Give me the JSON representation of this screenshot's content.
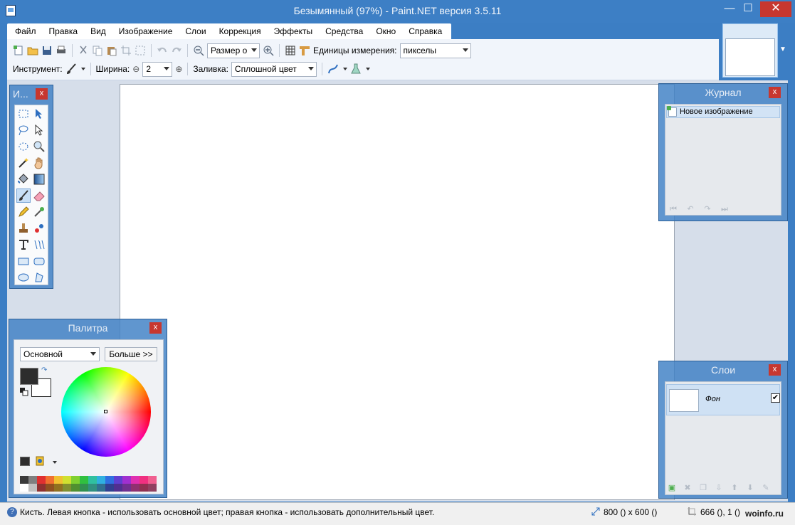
{
  "window": {
    "title": "Безымянный (97%) - Paint.NET версия 3.5.11",
    "minimize_label": "—",
    "maximize_label": "☐",
    "close_label": "✕"
  },
  "menu": {
    "items": [
      "Файл",
      "Правка",
      "Вид",
      "Изображение",
      "Слои",
      "Коррекция",
      "Эффекты",
      "Средства",
      "Окно",
      "Справка"
    ]
  },
  "toolbar": {
    "zoom_value": "Размер о",
    "units_label": "Единицы измерения:",
    "units_value": "пикселы",
    "tool_label": "Инструмент:",
    "width_label": "Ширина:",
    "width_value": "2",
    "fill_label": "Заливка:",
    "fill_value": "Сплошной цвет",
    "minus_label": "⊖",
    "plus_label": "⊕"
  },
  "tools_panel": {
    "title": "И...",
    "close_label": "x",
    "tools": [
      "rectangle-select",
      "move-selection",
      "lasso-select",
      "move-selected-pixels",
      "ellipse-select",
      "zoom",
      "magic-wand",
      "pan",
      "paint-bucket",
      "gradient",
      "paintbrush",
      "eraser",
      "pencil",
      "color-picker",
      "clone-stamp",
      "recolor",
      "text",
      "line-curve",
      "rectangle",
      "rounded-rectangle",
      "ellipse",
      "freeform-shape"
    ],
    "selected": "paintbrush"
  },
  "palette_panel": {
    "title": "Палитра",
    "close_label": "x",
    "palette_value": "Основной",
    "more_button": "Больше >>",
    "primary_color": "#2d2d2d",
    "secondary_color": "#ffffff",
    "swatches": [
      "#3a3a3a",
      "#7f7f7f",
      "#e03030",
      "#f07030",
      "#f0c030",
      "#d0e030",
      "#80d030",
      "#30c040",
      "#30c0a0",
      "#30b0e0",
      "#3070e0",
      "#6040d0",
      "#a030d0",
      "#e030b0",
      "#f03080",
      "#f06090",
      "#ffffff",
      "#c0c0c0",
      "#903030",
      "#905020",
      "#907020",
      "#809030",
      "#509030",
      "#309050",
      "#309080",
      "#307090",
      "#304090",
      "#503090",
      "#703090",
      "#903070",
      "#903050",
      "#904060"
    ]
  },
  "journal_panel": {
    "title": "Журнал",
    "close_label": "x",
    "items": [
      "Новое изображение"
    ]
  },
  "layers_panel": {
    "title": "Слои",
    "close_label": "x",
    "layers": [
      {
        "name": "Фон",
        "visible": true
      }
    ]
  },
  "statusbar": {
    "hint": "Кисть. Левая кнопка - использовать основной цвет; правая кнопка - использовать дополнительный цвет.",
    "image_size": "800 () x 600 ()",
    "cursor_pos": "666 (), 1 ()"
  },
  "watermark": "woinfo.ru",
  "colors": {
    "title_bar": "#3d7fc5",
    "close_button": "#c7372f",
    "workspace": "#d6deea"
  }
}
